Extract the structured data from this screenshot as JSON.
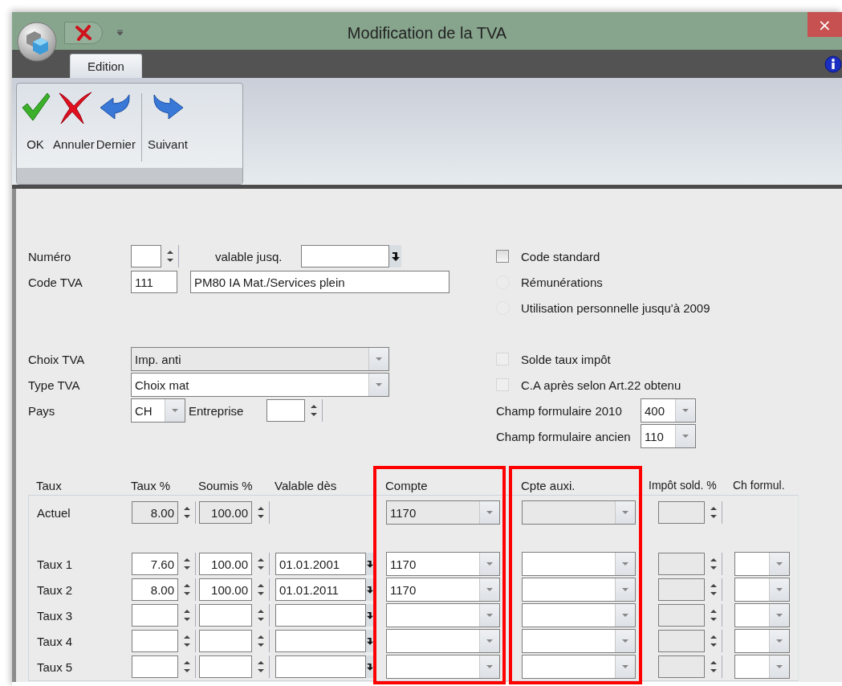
{
  "window": {
    "title": "Modification de la TVA",
    "close": "×"
  },
  "tabs": [
    {
      "label": "Edition",
      "selected": true
    }
  ],
  "ribbon": {
    "buttons": [
      {
        "label": "OK",
        "kind": "ok"
      },
      {
        "label": "Annuler",
        "kind": "cancel"
      },
      {
        "label": "Dernier",
        "kind": "back"
      },
      {
        "label": "Suivant",
        "kind": "next",
        "separator_before": true
      }
    ]
  },
  "form": {
    "numero": {
      "label": "Numéro"
    },
    "valid_until": {
      "label": "valable jusq."
    },
    "code_tva": {
      "label": "Code TVA",
      "code": "111",
      "description": "PM80 IA Mat./Services plein"
    },
    "choix_tva": {
      "label": "Choix TVA",
      "value": "Imp. anti",
      "disabled": true
    },
    "type_tva": {
      "label": "Type TVA",
      "value": "Choix mat",
      "disabled": false
    },
    "pays": {
      "label": "Pays",
      "value": "CH"
    },
    "entreprise": {
      "label": "Entreprise"
    },
    "options": [
      {
        "kind": "checkbox",
        "label": "Code standard",
        "checked": false,
        "disabled": false
      },
      {
        "kind": "radio",
        "label": "Rémunérations",
        "checked": false,
        "disabled": true
      },
      {
        "kind": "radio",
        "label": "Utilisation personnelle jusqu'à 2009",
        "checked": false,
        "disabled": true
      },
      {
        "kind": "gap"
      },
      {
        "kind": "checkbox",
        "label": "Solde taux impôt",
        "checked": false,
        "disabled": true
      },
      {
        "kind": "checkbox",
        "label": "C.A après selon Art.22 obtenu",
        "checked": false,
        "disabled": true
      },
      {
        "kind": "combo",
        "label": "Champ formulaire 2010",
        "value": "400"
      },
      {
        "kind": "combo",
        "label": "Champ formulaire ancien",
        "value": "110"
      }
    ]
  },
  "table": {
    "columns": [
      {
        "label": "Taux",
        "highlighted": false
      },
      {
        "label": "Taux %",
        "highlighted": false
      },
      {
        "label": "Soumis %",
        "highlighted": false
      },
      {
        "label": "Valable dès",
        "highlighted": false
      },
      {
        "label": "Compte",
        "highlighted": true
      },
      {
        "label": "Cpte auxi.",
        "highlighted": true
      },
      {
        "label": "Impôt sold. %",
        "highlighted": false
      },
      {
        "label": "Ch formul.",
        "highlighted": false
      }
    ],
    "rows": [
      {
        "label": "Actuel",
        "kind": "current",
        "rate": "8.00",
        "subject": "100.00",
        "account": "1170"
      },
      {
        "label": "Taux 1",
        "kind": "rate",
        "rate": "7.60",
        "subject": "100.00",
        "valid_from": "01.01.2001",
        "account": "1170"
      },
      {
        "label": "Taux 2",
        "kind": "rate",
        "rate": "8.00",
        "subject": "100.00",
        "valid_from": "01.01.2011",
        "account": "1170"
      },
      {
        "label": "Taux 3",
        "kind": "rate"
      },
      {
        "label": "Taux 4",
        "kind": "rate"
      },
      {
        "label": "Taux 5",
        "kind": "rate"
      }
    ]
  }
}
